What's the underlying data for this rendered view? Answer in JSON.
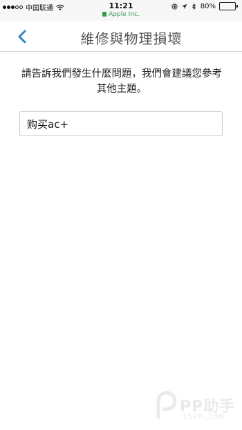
{
  "status_bar": {
    "carrier": "中国联通",
    "time": "11:21",
    "url": "Apple Inc.",
    "battery_percent": "80%",
    "battery_level": 0.8,
    "signal_bars_filled": 3,
    "signal_bars_total": 5
  },
  "nav": {
    "title": "維修與物理損壞"
  },
  "main": {
    "prompt": "請告訴我們發生什麼問題，我們會建議您參考其他主題。",
    "search_value": "购买ac+"
  },
  "watermark": {
    "brand": "PP助手",
    "site": "25PP.COM"
  },
  "colors": {
    "accent": "#2a86c7",
    "url_green": "#33a14a"
  }
}
